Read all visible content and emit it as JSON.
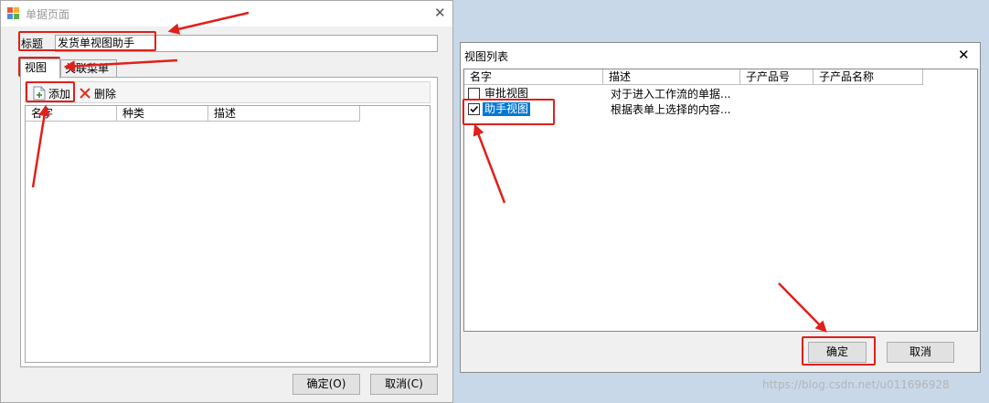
{
  "left_window": {
    "title": "单据页面",
    "title_label": "标题",
    "title_value": "发货单视图助手",
    "tabs": [
      {
        "label": "视图"
      },
      {
        "label": "关联菜单"
      }
    ],
    "toolbar": {
      "add_label": "添加",
      "delete_label": "删除"
    },
    "columns": [
      "名字",
      "种类",
      "描述"
    ],
    "ok_label": "确定(O)",
    "cancel_label": "取消(C)"
  },
  "right_window": {
    "title": "视图列表",
    "columns": [
      "名字",
      "描述",
      "子产品号",
      "子产品名称"
    ],
    "rows": [
      {
        "name": "审批视图",
        "description": "对于进入工作流的单据...",
        "checked": false
      },
      {
        "name": "助手视图",
        "description": "根据表单上选择的内容...",
        "checked": true
      }
    ],
    "ok_label": "确定",
    "cancel_label": "取消"
  },
  "watermark": "https://blog.csdn.net/u011696928",
  "colors": {
    "annotation": "#e0201b",
    "selection": "#0078d7",
    "desktop": "#c9d8e8"
  }
}
